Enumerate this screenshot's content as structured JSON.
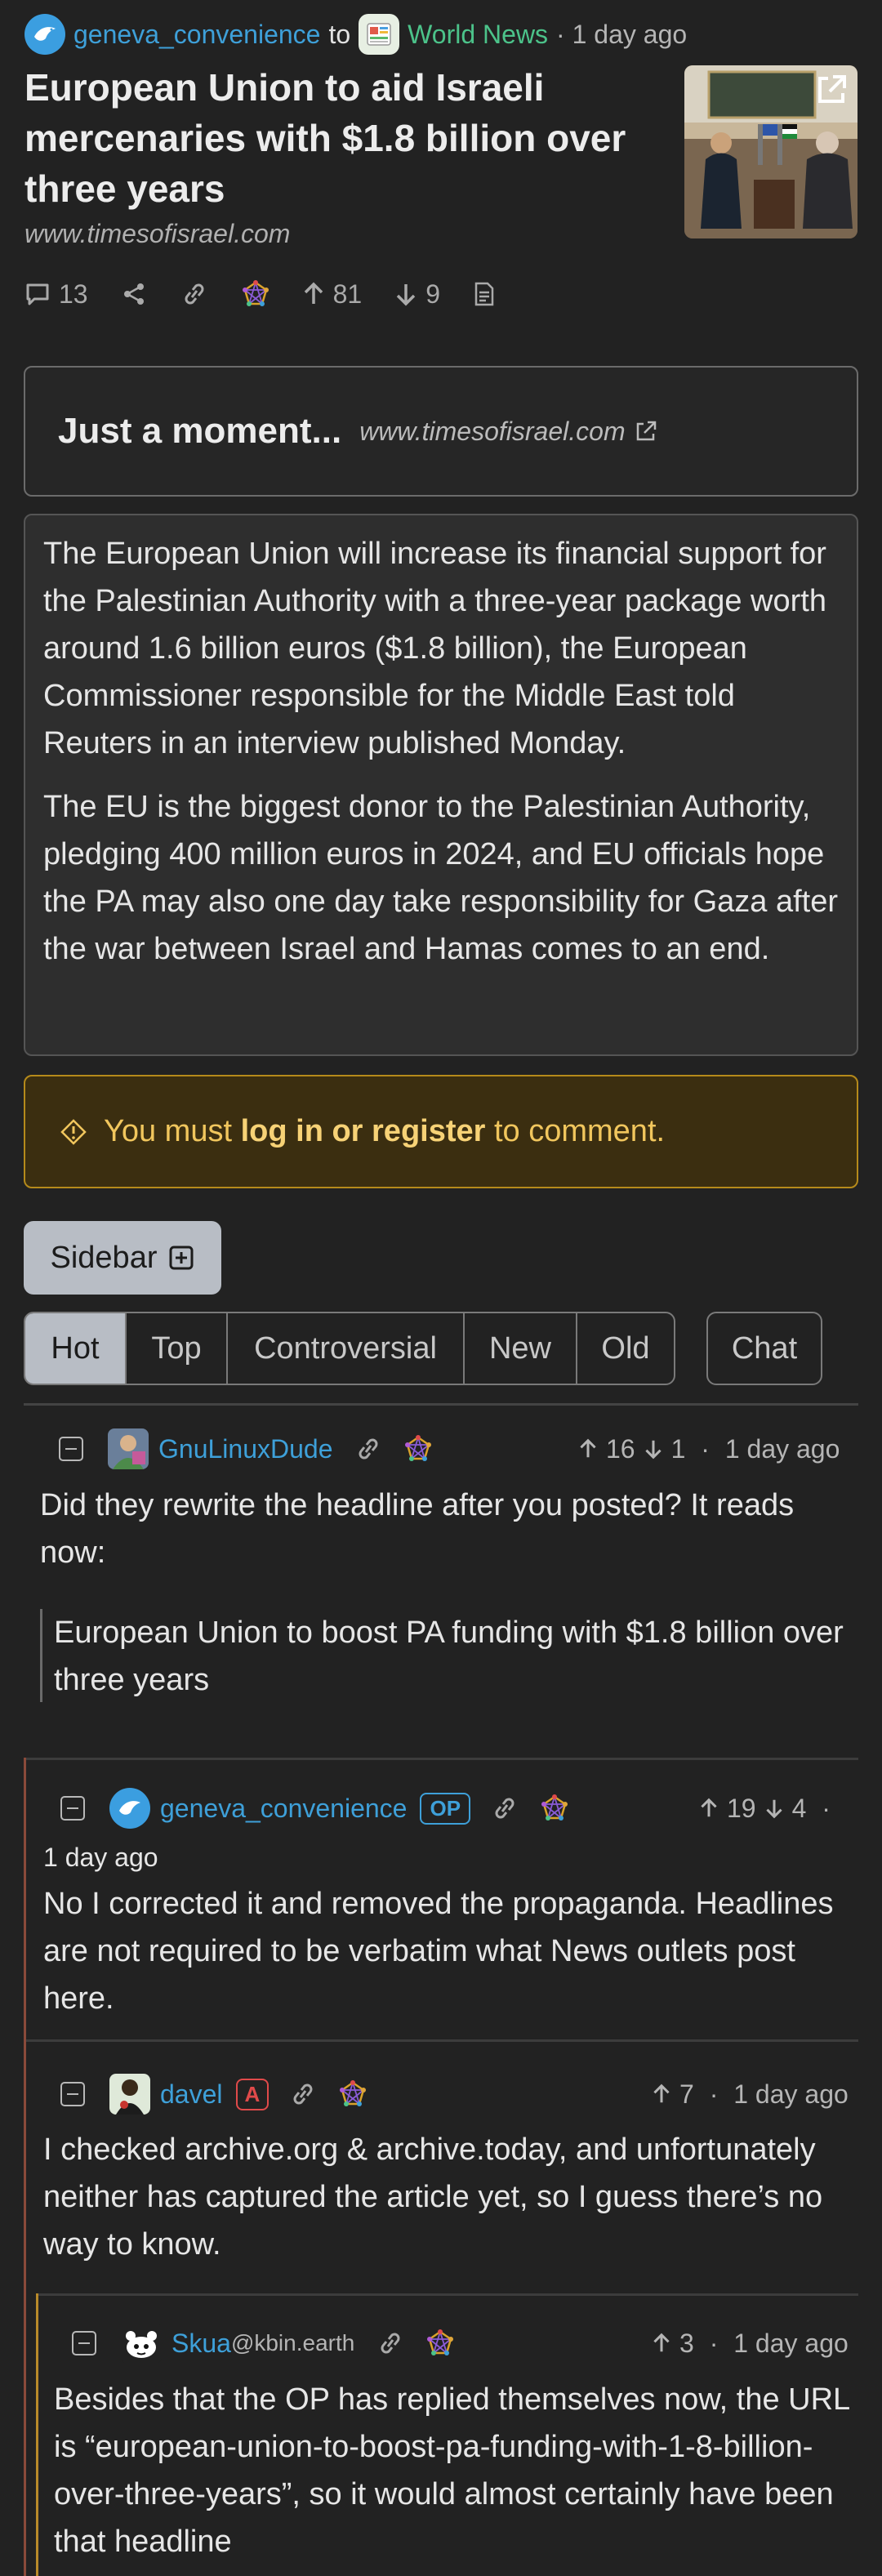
{
  "post": {
    "author": "geneva_convenience",
    "to_word": "to",
    "community": "World News",
    "time": "· 1 day ago",
    "title": "European Union to aid Israeli mercenaries with $1.8 billion over three years",
    "domain": "www.timesofisrael.com",
    "comment_count": "13",
    "upvotes": "81",
    "downvotes": "9"
  },
  "embed": {
    "title": "Just a moment...",
    "domain": "www.timesofisrael.com"
  },
  "body": {
    "p1": "The European Union will increase its financial support for the Palestinian Authority with a three-year package worth around 1.6 billion euros ($1.8 billion), the European Commissioner responsible for the Middle East told Reuters in an interview published Monday.",
    "p2": "The EU is the biggest donor to the Palestinian Authority, pledging 400 million euros in 2024, and EU officials hope the PA may also one day take responsibility for Gaza after the war between Israel and Hamas comes to an end."
  },
  "alert": {
    "prefix": "You must",
    "link": "log in or register",
    "suffix": "to comment."
  },
  "sidebar_label": "Sidebar",
  "sort_tabs": [
    "Hot",
    "Top",
    "Controversial",
    "New",
    "Old"
  ],
  "chat_label": "Chat",
  "comments": [
    {
      "author": "GnuLinuxDude",
      "up": "16",
      "down": "1",
      "time": "1 day ago",
      "text": "Did they rewrite the headline after you posted? It reads now:",
      "quote": "European Union to boost PA funding with $1.8 billion over three years"
    },
    {
      "author": "geneva_convenience",
      "badge": "OP",
      "up": "19",
      "down": "4",
      "time": "1 day ago",
      "text": "No I corrected it and removed the propaganda. Headlines are not required to be verbatim what News outlets post here."
    },
    {
      "author": "davel",
      "badge": "A",
      "up": "7",
      "time": "1 day ago",
      "text": "I checked archive.org & archive.today, and unfortunately neither has captured the article yet, so I guess there’s no way to know."
    },
    {
      "author": "Skua",
      "instance": "@kbin.earth",
      "up": "3",
      "time": "1 day ago",
      "text": "Besides that the OP has replied themselves now, the URL is “european-union-to-boost-pa-funding-with-1-8-billion-over-three-years”, so it would almost certainly have been that headline"
    }
  ],
  "colors": {
    "background": "#222222",
    "link": "#3ea0d9",
    "community": "#4cc38a",
    "alert_bg": "#3b2e10",
    "alert_text": "#f1c65d"
  }
}
